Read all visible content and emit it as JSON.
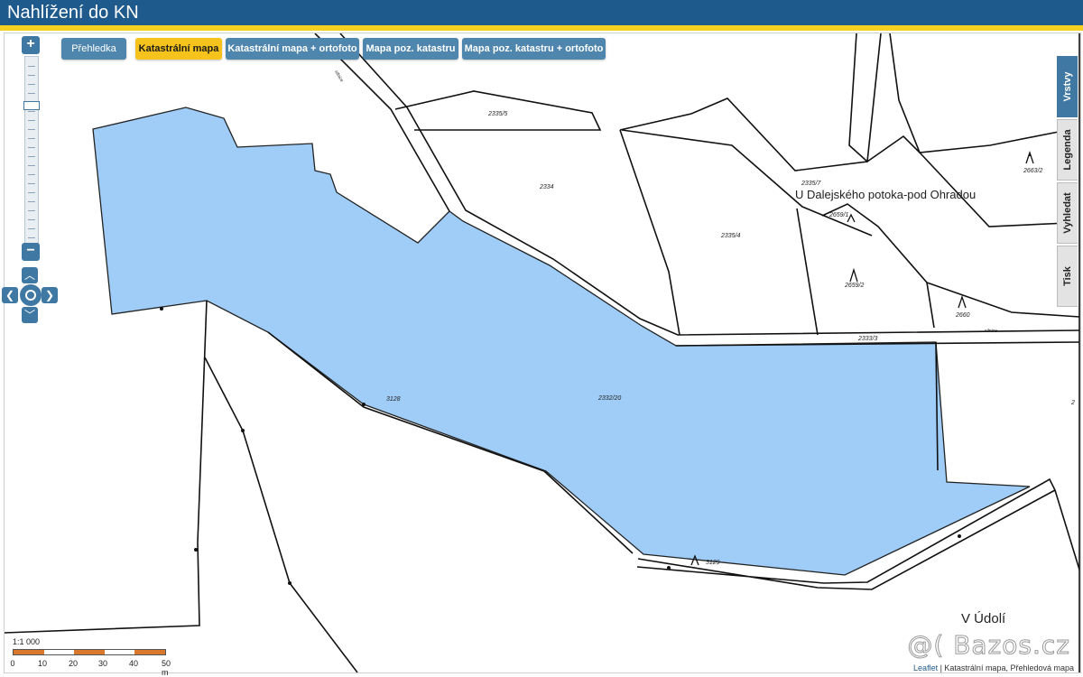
{
  "app": {
    "title": "Nahlížení do KN"
  },
  "tabs": [
    {
      "label": "Přehledka"
    },
    {
      "label": "Katastrální mapa"
    },
    {
      "label": "Katastrální mapa + ortofoto"
    },
    {
      "label": "Mapa poz. katastru"
    },
    {
      "label": "Mapa poz. katastru + ortofoto"
    }
  ],
  "side_panel": [
    {
      "label": "Vrstvy"
    },
    {
      "label": "Legenda"
    },
    {
      "label": "Vyhledat"
    },
    {
      "label": "Tisk"
    }
  ],
  "zoom": {
    "in_label": "+",
    "out_label": "−"
  },
  "pan": {
    "left": "❮",
    "right": "❯",
    "up": "︿",
    "down": "﹀"
  },
  "map": {
    "parcels": [
      "2335/5",
      "2334",
      "2335/4",
      "2335/7",
      "2659/1",
      "2659/2",
      "2663/2",
      "2660",
      "2333/3",
      "2332/20",
      "3128",
      "3129",
      "2"
    ],
    "roads": [
      "silnice",
      "silnice"
    ],
    "localities": [
      "U Dalejského potoka-pod Ohradou",
      "V Údolí"
    ],
    "icons": [
      "forest-symbol",
      "forest-symbol",
      "forest-symbol",
      "forest-symbol",
      "forest-symbol"
    ]
  },
  "scale": {
    "ratio": "1:1 000",
    "ticks": [
      "0",
      "10",
      "20",
      "30",
      "40",
      "50 m"
    ]
  },
  "attribution": {
    "link": "Leaflet",
    "text": " | Katastrální mapa, Přehledová mapa"
  },
  "watermark": "@( Bazos.cz",
  "colors": {
    "header": "#1f5a8c",
    "accent": "#f5c31c",
    "parcel_fill": "#9fcdf8",
    "button": "#4f86ad"
  }
}
